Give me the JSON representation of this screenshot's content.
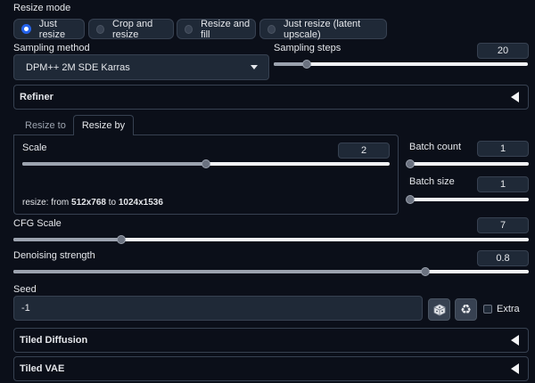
{
  "resize_mode": {
    "label": "Resize mode",
    "options": [
      "Just resize",
      "Crop and resize",
      "Resize and fill",
      "Just resize (latent upscale)"
    ],
    "selected": "Just resize"
  },
  "sampling": {
    "method_label": "Sampling method",
    "method_value": "DPM++ 2M SDE Karras",
    "steps_label": "Sampling steps",
    "steps_value": "20",
    "steps_fraction": 0.13
  },
  "refiner": {
    "label": "Refiner"
  },
  "tabs": {
    "resize_to": "Resize to",
    "resize_by": "Resize by"
  },
  "scale": {
    "label": "Scale",
    "value": "2",
    "fraction": 0.5,
    "resize_prefix": "resize: from ",
    "from": "512x768",
    "to_word": " to ",
    "to": "1024x1536"
  },
  "batch_count": {
    "label": "Batch count",
    "value": "1",
    "fraction": 0.0
  },
  "batch_size": {
    "label": "Batch size",
    "value": "1",
    "fraction": 0.0
  },
  "cfg": {
    "label": "CFG Scale",
    "value": "7",
    "fraction": 0.21
  },
  "denoise": {
    "label": "Denoising strength",
    "value": "0.8",
    "fraction": 0.8
  },
  "seed": {
    "label": "Seed",
    "value": "-1",
    "extra_label": "Extra"
  },
  "tiled_diffusion": {
    "label": "Tiled Diffusion"
  },
  "tiled_vae": {
    "label": "Tiled VAE"
  },
  "colors": {
    "accent": "#2563eb",
    "background": "#0b0f19",
    "panel": "#1f2937"
  }
}
